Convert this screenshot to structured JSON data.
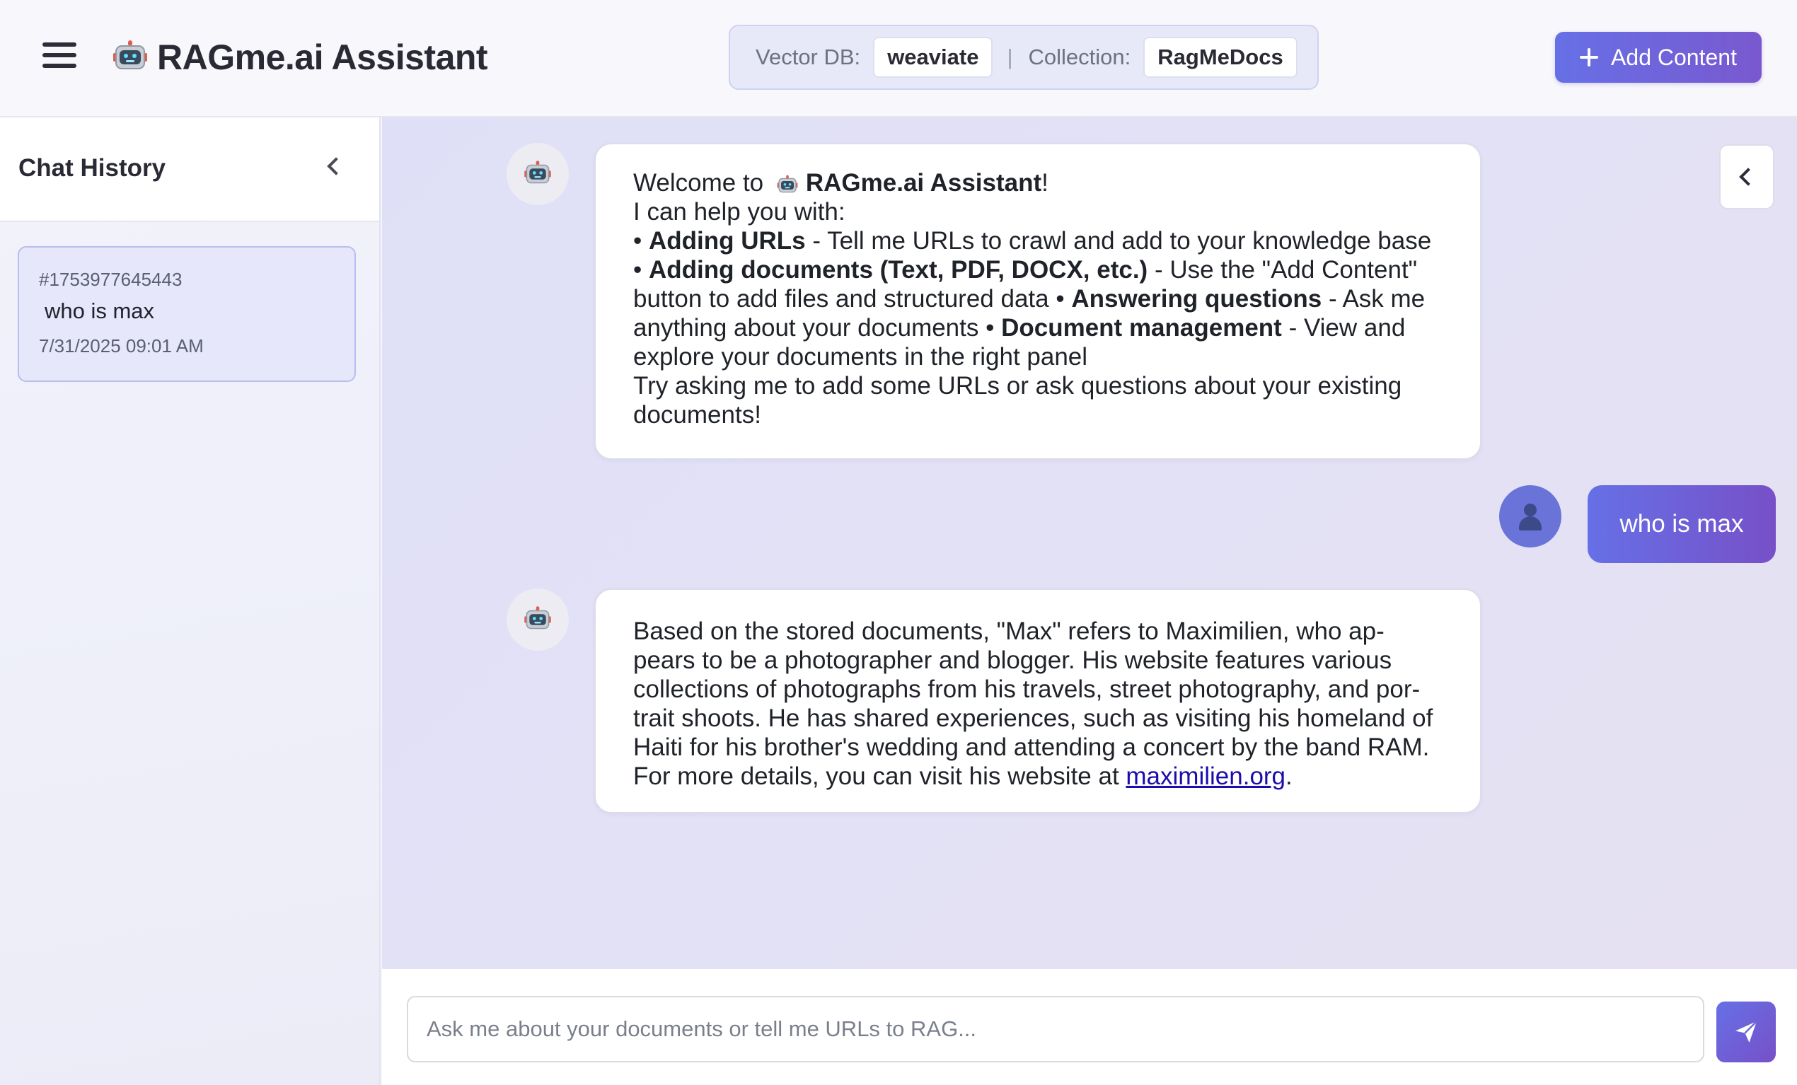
{
  "header": {
    "title": "RAGme.ai Assistant",
    "vector_db_label": "Vector DB:",
    "vector_db_value": "weaviate",
    "separator": "|",
    "collection_label": "Collection:",
    "collection_value": "RagMeDocs",
    "add_content_label": "Add Content"
  },
  "sidebar": {
    "title": "Chat History",
    "items": [
      {
        "id": "#1753977645443",
        "question": "who is max",
        "date": "7/31/2025 09:01 AM"
      }
    ]
  },
  "chat": {
    "welcome": {
      "greeting_prefix": "Welcome to ",
      "greeting_name": "RAGme.ai Assistant",
      "greeting_suffix": "!",
      "intro": "I can help you with:",
      "b1_bullet": "• ",
      "b1_title": "Adding URLs",
      "b1_text": " - Tell me URLs to crawl and add to your knowledge base",
      "b2_bullet": "• ",
      "b2_title": "Adding documents (Text, PDF, DOCX, etc.)",
      "b2_text1": " - Use the \"Add Content\"",
      "b2_text2": "button to add files and structured data ",
      "b3_bullet": "• ",
      "b3_title": "Answering questions",
      "b3_text1": " - Ask me",
      "b3_text2": "anything about your documents ",
      "b4_bullet": "• ",
      "b4_title": "Document management",
      "b4_text1": " - View and",
      "b4_text2": "explore your documents in the right panel",
      "outro1": "Try asking me to add some URLs or ask questions about your existing",
      "outro2": "documents!"
    },
    "user_message": "who is max",
    "answer": {
      "line1": "Based on the stored documents, \"Max\" refers to Maximilien, who ap-",
      "line2": "pears to be a photographer and blogger. His website features various",
      "line3": "collections of photographs from his travels, street photography, and por-",
      "line4": "trait shoots. He has shared experiences, such as visiting his homeland of",
      "line5": "Haiti for his brother's wedding and attending a concert by the band RAM.",
      "line6_prefix": "For more details, you can visit his website at ",
      "link_text": "maximilien.org",
      "line6_suffix": "."
    }
  },
  "input": {
    "placeholder": "Ask me about your documents or tell me URLs to RAG..."
  },
  "icons": {
    "menu": "hamburger-icon",
    "brand": "robot-icon",
    "add": "plus-icon",
    "collapse": "chevron-left-icon",
    "user": "user-silhouette-icon",
    "send": "paper-plane-icon"
  },
  "colors": {
    "accent_start": "#6670e6",
    "accent_end": "#7750c8",
    "link": "#1a0dab"
  }
}
